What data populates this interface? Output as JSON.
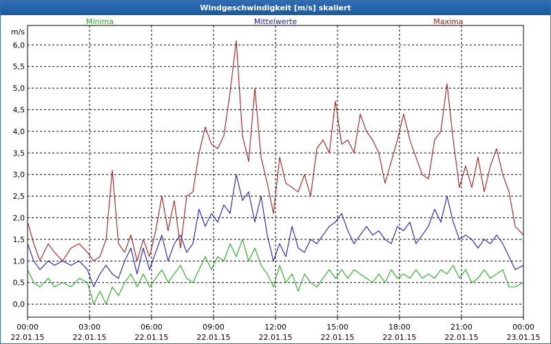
{
  "chart_data": {
    "type": "line",
    "title": "Windgeschwindigkeit [m/s] skaliert",
    "ylabel": "m/s",
    "ylim": [
      -0.3,
      6.45
    ],
    "yticks": [
      "0,0",
      "0,5",
      "1,0",
      "1,5",
      "2,0",
      "2,5",
      "3,0",
      "3,5",
      "4,0",
      "4,5",
      "5,0",
      "5,5",
      "6,0"
    ],
    "xrange_hours": [
      0,
      24
    ],
    "xticks": [
      {
        "time": "00:00",
        "date": "22.01.15"
      },
      {
        "time": "03:00",
        "date": "22.01.15"
      },
      {
        "time": "06:00",
        "date": "22.01.15"
      },
      {
        "time": "09:00",
        "date": "22.01.15"
      },
      {
        "time": "12:00",
        "date": "22.01.15"
      },
      {
        "time": "15:00",
        "date": "22.01.15"
      },
      {
        "time": "18:00",
        "date": "22.01.15"
      },
      {
        "time": "21:00",
        "date": "22.01.15"
      },
      {
        "time": "00:00",
        "date": "23.01.15"
      }
    ],
    "grid": true,
    "legend_position": "top",
    "series": [
      {
        "name": "Minima",
        "color": "#1fae1f",
        "points": [
          [
            0,
            0.8
          ],
          [
            0.3,
            0.5
          ],
          [
            0.6,
            0.4
          ],
          [
            1.0,
            0.6
          ],
          [
            1.3,
            0.4
          ],
          [
            1.7,
            0.5
          ],
          [
            2.1,
            0.4
          ],
          [
            2.5,
            0.6
          ],
          [
            2.9,
            0.5
          ],
          [
            3.2,
            0.0
          ],
          [
            3.5,
            0.3
          ],
          [
            3.8,
            0.0
          ],
          [
            4.1,
            0.4
          ],
          [
            4.4,
            0.2
          ],
          [
            4.7,
            0.5
          ],
          [
            5.0,
            0.7
          ],
          [
            5.3,
            0.4
          ],
          [
            5.6,
            0.7
          ],
          [
            5.9,
            0.4
          ],
          [
            6.2,
            0.6
          ],
          [
            6.5,
            0.8
          ],
          [
            6.8,
            0.5
          ],
          [
            7.1,
            0.7
          ],
          [
            7.4,
            0.9
          ],
          [
            7.7,
            0.6
          ],
          [
            8.0,
            0.5
          ],
          [
            8.3,
            0.8
          ],
          [
            8.6,
            1.1
          ],
          [
            8.9,
            0.8
          ],
          [
            9.2,
            1.1
          ],
          [
            9.5,
            1.0
          ],
          [
            9.8,
            1.4
          ],
          [
            10.1,
            1.1
          ],
          [
            10.4,
            1.5
          ],
          [
            10.7,
            1.0
          ],
          [
            11.0,
            1.3
          ],
          [
            11.3,
            0.9
          ],
          [
            11.6,
            0.7
          ],
          [
            11.9,
            0.4
          ],
          [
            12.2,
            0.9
          ],
          [
            12.5,
            0.5
          ],
          [
            12.8,
            0.7
          ],
          [
            13.1,
            0.3
          ],
          [
            13.4,
            0.7
          ],
          [
            13.7,
            0.5
          ],
          [
            14.0,
            0.4
          ],
          [
            14.3,
            0.6
          ],
          [
            14.6,
            0.8
          ],
          [
            14.9,
            0.6
          ],
          [
            15.2,
            0.8
          ],
          [
            15.5,
            0.6
          ],
          [
            15.8,
            0.8
          ],
          [
            16.1,
            0.7
          ],
          [
            16.4,
            0.6
          ],
          [
            16.7,
            0.5
          ],
          [
            17.0,
            0.7
          ],
          [
            17.3,
            0.5
          ],
          [
            17.6,
            0.8
          ],
          [
            17.9,
            0.6
          ],
          [
            18.2,
            0.7
          ],
          [
            18.5,
            0.6
          ],
          [
            18.8,
            0.8
          ],
          [
            19.1,
            0.6
          ],
          [
            19.4,
            0.7
          ],
          [
            19.7,
            0.6
          ],
          [
            20.0,
            0.8
          ],
          [
            20.3,
            0.7
          ],
          [
            20.6,
            0.9
          ],
          [
            20.9,
            0.6
          ],
          [
            21.2,
            0.8
          ],
          [
            21.5,
            0.5
          ],
          [
            21.8,
            0.6
          ],
          [
            22.1,
            0.8
          ],
          [
            22.4,
            0.6
          ],
          [
            22.7,
            0.7
          ],
          [
            23.0,
            0.8
          ],
          [
            23.3,
            0.4
          ],
          [
            23.6,
            0.4
          ],
          [
            24.0,
            0.5
          ]
        ]
      },
      {
        "name": "Mittelwerte",
        "color": "#1a1ac8",
        "points": [
          [
            0,
            1.4
          ],
          [
            0.3,
            1.0
          ],
          [
            0.6,
            0.8
          ],
          [
            1.0,
            1.0
          ],
          [
            1.3,
            0.9
          ],
          [
            1.7,
            1.0
          ],
          [
            2.1,
            0.9
          ],
          [
            2.5,
            1.0
          ],
          [
            2.9,
            0.8
          ],
          [
            3.2,
            0.4
          ],
          [
            3.5,
            0.7
          ],
          [
            3.8,
            0.9
          ],
          [
            4.1,
            0.7
          ],
          [
            4.4,
            0.6
          ],
          [
            4.7,
            1.0
          ],
          [
            5.0,
            1.3
          ],
          [
            5.3,
            0.7
          ],
          [
            5.6,
            1.3
          ],
          [
            5.9,
            0.8
          ],
          [
            6.2,
            1.2
          ],
          [
            6.5,
            1.6
          ],
          [
            6.8,
            1.0
          ],
          [
            7.1,
            1.4
          ],
          [
            7.4,
            1.6
          ],
          [
            7.7,
            1.2
          ],
          [
            8.0,
            1.4
          ],
          [
            8.3,
            2.2
          ],
          [
            8.6,
            1.8
          ],
          [
            8.9,
            2.1
          ],
          [
            9.2,
            1.9
          ],
          [
            9.5,
            2.3
          ],
          [
            9.8,
            2.1
          ],
          [
            10.1,
            3.0
          ],
          [
            10.4,
            2.4
          ],
          [
            10.7,
            2.6
          ],
          [
            11.0,
            1.9
          ],
          [
            11.3,
            2.5
          ],
          [
            11.6,
            1.6
          ],
          [
            11.9,
            1.0
          ],
          [
            12.2,
            1.4
          ],
          [
            12.5,
            1.1
          ],
          [
            12.8,
            1.8
          ],
          [
            13.1,
            1.3
          ],
          [
            13.4,
            1.2
          ],
          [
            13.7,
            1.5
          ],
          [
            14.0,
            1.4
          ],
          [
            14.3,
            1.6
          ],
          [
            14.6,
            1.8
          ],
          [
            14.9,
            1.9
          ],
          [
            15.2,
            2.1
          ],
          [
            15.5,
            1.7
          ],
          [
            15.8,
            1.4
          ],
          [
            16.1,
            1.6
          ],
          [
            16.4,
            1.8
          ],
          [
            16.7,
            1.6
          ],
          [
            17.0,
            1.7
          ],
          [
            17.3,
            1.5
          ],
          [
            17.6,
            1.4
          ],
          [
            17.9,
            1.8
          ],
          [
            18.2,
            1.7
          ],
          [
            18.5,
            1.9
          ],
          [
            18.8,
            1.4
          ],
          [
            19.1,
            1.6
          ],
          [
            19.4,
            1.8
          ],
          [
            19.7,
            2.2
          ],
          [
            20.0,
            1.9
          ],
          [
            20.3,
            2.5
          ],
          [
            20.6,
            1.9
          ],
          [
            20.9,
            1.5
          ],
          [
            21.2,
            1.6
          ],
          [
            21.5,
            1.5
          ],
          [
            21.8,
            1.3
          ],
          [
            22.1,
            1.5
          ],
          [
            22.4,
            1.4
          ],
          [
            22.7,
            1.6
          ],
          [
            23.0,
            1.4
          ],
          [
            23.3,
            1.1
          ],
          [
            23.6,
            0.8
          ],
          [
            24.0,
            0.9
          ]
        ]
      },
      {
        "name": "Maxima",
        "color": "#b01818",
        "points": [
          [
            0,
            1.9
          ],
          [
            0.3,
            1.4
          ],
          [
            0.6,
            1.0
          ],
          [
            1.0,
            1.4
          ],
          [
            1.3,
            1.2
          ],
          [
            1.7,
            1.0
          ],
          [
            2.1,
            1.3
          ],
          [
            2.5,
            1.4
          ],
          [
            2.9,
            1.2
          ],
          [
            3.2,
            1.0
          ],
          [
            3.5,
            1.1
          ],
          [
            3.8,
            1.5
          ],
          [
            4.1,
            3.1
          ],
          [
            4.4,
            1.4
          ],
          [
            4.7,
            1.2
          ],
          [
            5.0,
            1.6
          ],
          [
            5.3,
            1.0
          ],
          [
            5.6,
            1.5
          ],
          [
            5.9,
            1.1
          ],
          [
            6.2,
            1.7
          ],
          [
            6.5,
            2.5
          ],
          [
            6.8,
            1.7
          ],
          [
            7.1,
            2.4
          ],
          [
            7.4,
            1.3
          ],
          [
            7.7,
            2.5
          ],
          [
            8.0,
            2.6
          ],
          [
            8.3,
            3.5
          ],
          [
            8.6,
            4.1
          ],
          [
            8.9,
            3.7
          ],
          [
            9.2,
            3.6
          ],
          [
            9.5,
            3.9
          ],
          [
            9.8,
            4.9
          ],
          [
            10.1,
            6.1
          ],
          [
            10.4,
            3.9
          ],
          [
            10.7,
            3.3
          ],
          [
            11.0,
            5.0
          ],
          [
            11.3,
            3.4
          ],
          [
            11.6,
            2.8
          ],
          [
            11.9,
            2.1
          ],
          [
            12.2,
            3.4
          ],
          [
            12.5,
            2.8
          ],
          [
            12.8,
            2.7
          ],
          [
            13.1,
            2.6
          ],
          [
            13.4,
            3.0
          ],
          [
            13.7,
            2.5
          ],
          [
            14.0,
            3.6
          ],
          [
            14.3,
            3.8
          ],
          [
            14.6,
            3.5
          ],
          [
            14.9,
            4.7
          ],
          [
            15.2,
            3.7
          ],
          [
            15.5,
            3.8
          ],
          [
            15.8,
            3.5
          ],
          [
            16.1,
            4.4
          ],
          [
            16.4,
            4.0
          ],
          [
            16.7,
            3.8
          ],
          [
            17.0,
            3.5
          ],
          [
            17.3,
            2.8
          ],
          [
            17.6,
            3.3
          ],
          [
            17.9,
            3.8
          ],
          [
            18.2,
            4.4
          ],
          [
            18.5,
            3.8
          ],
          [
            18.8,
            3.4
          ],
          [
            19.1,
            3.0
          ],
          [
            19.4,
            2.9
          ],
          [
            19.7,
            3.8
          ],
          [
            20.0,
            4.0
          ],
          [
            20.3,
            5.1
          ],
          [
            20.6,
            3.8
          ],
          [
            20.9,
            2.7
          ],
          [
            21.2,
            3.2
          ],
          [
            21.5,
            2.7
          ],
          [
            21.8,
            3.4
          ],
          [
            22.1,
            2.6
          ],
          [
            22.4,
            3.2
          ],
          [
            22.7,
            3.6
          ],
          [
            23.0,
            3.0
          ],
          [
            23.3,
            2.6
          ],
          [
            23.6,
            1.8
          ],
          [
            24.0,
            1.6
          ]
        ]
      }
    ]
  }
}
